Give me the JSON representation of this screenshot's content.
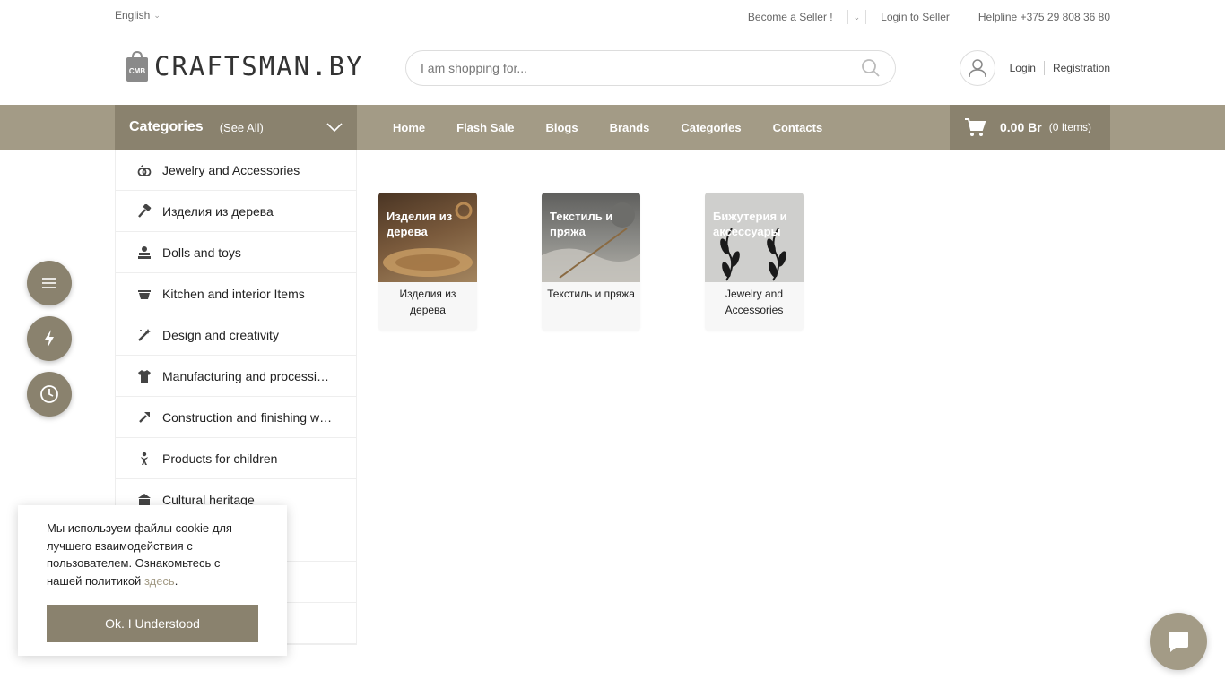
{
  "topbar": {
    "language": "English",
    "become_seller": "Become a Seller !",
    "login_seller": "Login to Seller",
    "helpline": "Helpline +375 29 808 36 80"
  },
  "header": {
    "logo_text": "CRAFTSMAN.BY",
    "logo_bag_text": "CMB",
    "search_placeholder": "I am shopping for...",
    "login": "Login",
    "registration": "Registration"
  },
  "nav": {
    "categories_title": "Categories",
    "see_all": "(See All)",
    "links": [
      "Home",
      "Flash Sale",
      "Blogs",
      "Brands",
      "Categories",
      "Contacts"
    ],
    "cart_amount": "0.00 Br",
    "cart_items": "(0 Items)"
  },
  "sidebar": {
    "items": [
      {
        "label": "Jewelry and Accessories",
        "icon": "rings-icon"
      },
      {
        "label": "Изделия из дерева",
        "icon": "hammer-icon"
      },
      {
        "label": "Dolls and toys",
        "icon": "toys-icon"
      },
      {
        "label": "Kitchen and interior Items",
        "icon": "bowl-icon"
      },
      {
        "label": "Design and creativity",
        "icon": "magic-wand-icon"
      },
      {
        "label": "Manufacturing and processi…",
        "icon": "tshirt-icon"
      },
      {
        "label": "Construction and finishing w…",
        "icon": "trowel-icon"
      },
      {
        "label": "Products for children",
        "icon": "child-icon"
      },
      {
        "label": "Cultural heritage",
        "icon": "heritage-icon"
      },
      {
        "label": "",
        "icon": ""
      },
      {
        "label": "",
        "icon": ""
      },
      {
        "label": "",
        "icon": ""
      }
    ]
  },
  "cards": [
    {
      "image_text": "Изделия из дерева",
      "caption": "Изделия из дерева",
      "bg": "#5a4330"
    },
    {
      "image_text": "Текстиль и пряжа",
      "caption": "Текстиль и пряжа",
      "bg": "#7a7a78"
    },
    {
      "image_text": "Бижутерия и аксессуары",
      "caption": "Jewelry and Accessories",
      "bg": "#c9c9c7"
    }
  ],
  "fabs": [
    "menu-icon",
    "flash-icon",
    "clock-icon"
  ],
  "cookie": {
    "text": "Мы используем файлы cookie для лучшего взаимодействия с пользователем. Ознакомьтесь с нашей политикой ",
    "link": "здесь",
    "after_link": ".",
    "button": "Ok. I Understood"
  },
  "colors": {
    "brand": "#8a826e",
    "brand_light": "#a39b86"
  }
}
